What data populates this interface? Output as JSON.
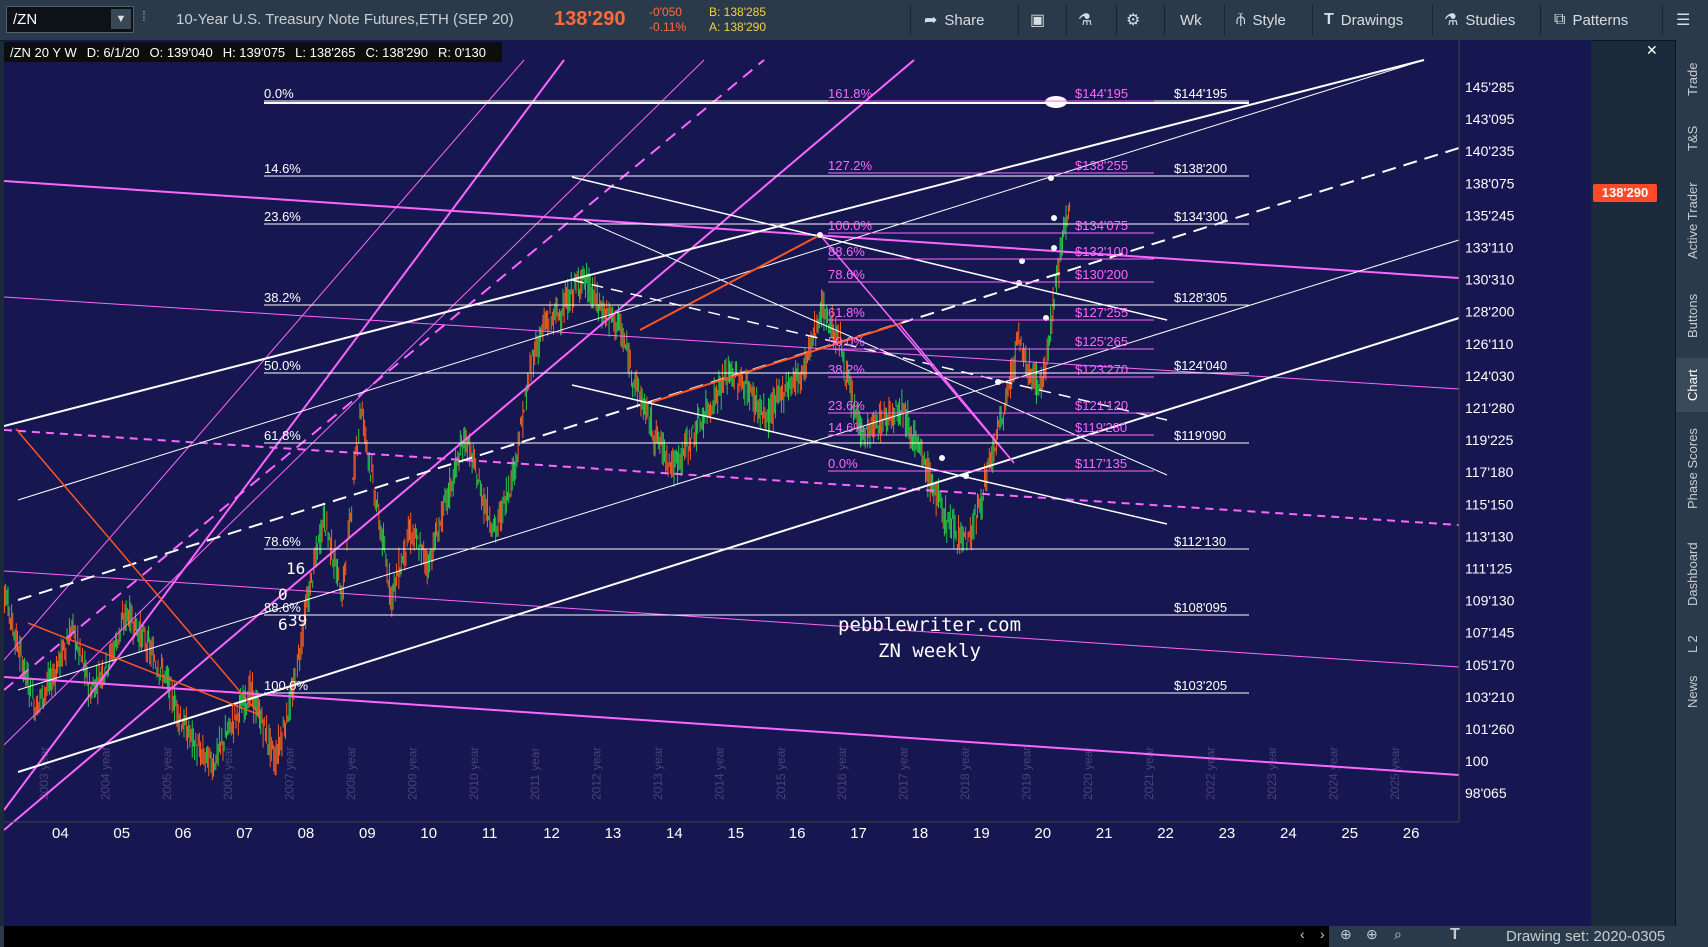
{
  "toolbar": {
    "symbol": "/ZN",
    "contract_name": "10-Year U.S. Treasury Note Futures,ETH (SEP 20)",
    "last_price": "138'290",
    "change": "-0'050",
    "change_pct": "-0.11%",
    "bid": "B: 138'285",
    "ask": "A: 138'290",
    "share_label": "Share",
    "timeframe_label": "Wk",
    "style_label": "Style",
    "drawings_label": "Drawings",
    "studies_label": "Studies",
    "patterns_label": "Patterns"
  },
  "info_bar": {
    "title": "/ZN 20 Y W",
    "date": "D: 6/1/20",
    "open": "O: 139'040",
    "high": "H: 139'075",
    "low": "L: 138'265",
    "close": "C: 138'290",
    "range": "R: 0'130"
  },
  "sidebar": {
    "tabs": [
      "Trade",
      "T&S",
      "Active Trader",
      "Buttons",
      "Chart",
      "Phase Scores",
      "Dashboard",
      "L 2",
      "News"
    ],
    "active": "Chart"
  },
  "bottom": {
    "drawing_set": "Drawing set: 2020-0305"
  },
  "chart_data": {
    "type": "candlestick",
    "watermark_lines": [
      "pebblewriter.com",
      "ZN weekly"
    ],
    "current_price": "138'290",
    "price_axis": [
      "145'285",
      "143'095",
      "140'235",
      "138'075",
      "135'245",
      "133'110",
      "130'310",
      "128'200",
      "126'110",
      "124'030",
      "121'280",
      "119'225",
      "117'180",
      "115'150",
      "113'130",
      "111'125",
      "109'130",
      "107'145",
      "105'170",
      "103'210",
      "101'260",
      "100",
      "98'065"
    ],
    "time_axis": [
      "04",
      "05",
      "06",
      "07",
      "08",
      "09",
      "10",
      "11",
      "12",
      "13",
      "14",
      "15",
      "16",
      "17",
      "18",
      "19",
      "20",
      "21",
      "22",
      "23",
      "24",
      "25",
      "26"
    ],
    "year_labels": [
      "2003 year",
      "2004 year",
      "2005 year",
      "2006 year",
      "2007 year",
      "2008 year",
      "2009 year",
      "2010 year",
      "2011 year",
      "2012 year",
      "2013 year",
      "2014 year",
      "2015 year",
      "2016 year",
      "2017 year",
      "2018 year",
      "2019 year",
      "2020 year",
      "2021 year",
      "2022 year",
      "2023 year",
      "2024 year",
      "2025 year"
    ],
    "fib_white": [
      {
        "pct": "0.0%",
        "price": "$144'195"
      },
      {
        "pct": "14.6%",
        "price": "$138'200"
      },
      {
        "pct": "23.6%",
        "price": "$134'300"
      },
      {
        "pct": "38.2%",
        "price": "$128'305"
      },
      {
        "pct": "50.0%",
        "price": "$124'040"
      },
      {
        "pct": "61.8%",
        "price": "$119'090"
      },
      {
        "pct": "78.6%",
        "price": "$112'130"
      },
      {
        "pct": "88.6%",
        "price": "$108'095"
      },
      {
        "pct": "100.0%",
        "price": "$103'205"
      }
    ],
    "fib_pink": [
      {
        "pct": "161.8%",
        "price": "$144'195"
      },
      {
        "pct": "127.2%",
        "price": "$138'255"
      },
      {
        "pct": "100.0%",
        "price": "$134'075"
      },
      {
        "pct": "88.6%",
        "price": "$132'100"
      },
      {
        "pct": "78.6%",
        "price": "$130'200"
      },
      {
        "pct": "61.8%",
        "price": "$127'255"
      },
      {
        "pct": "50.0%",
        "price": "$125'265"
      },
      {
        "pct": "38.2%",
        "price": "$123'270"
      },
      {
        "pct": "23.6%",
        "price": "$121'120"
      },
      {
        "pct": "14.6%",
        "price": "$119'280"
      },
      {
        "pct": "0.0%",
        "price": "$117'135"
      }
    ],
    "misc_labels": [
      "16",
      "0",
      "6",
      "39"
    ],
    "colors": {
      "background": "#161650",
      "up": "#22cc44",
      "down": "#ff5a1a",
      "pink": "#ff66ff",
      "white": "#ffffff",
      "orange": "#ff5522"
    }
  }
}
